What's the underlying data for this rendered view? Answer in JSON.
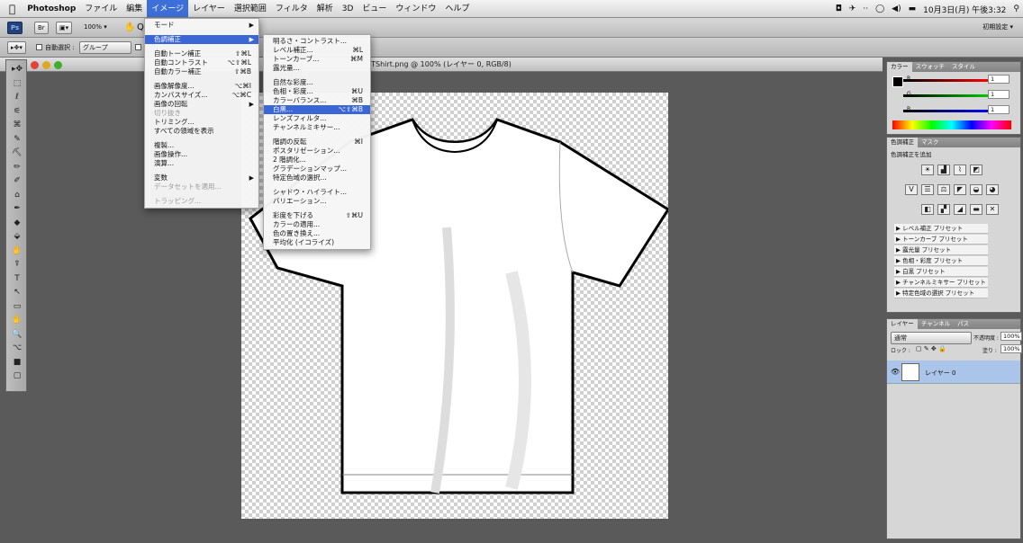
{
  "menubar": {
    "apple": "",
    "items": [
      "Photoshop",
      "ファイル",
      "編集",
      "イメージ",
      "レイヤー",
      "選択範囲",
      "フィルタ",
      "解析",
      "3D",
      "ビュー",
      "ウィンドウ",
      "ヘルプ"
    ],
    "status": [
      "◘",
      "✈",
      "··",
      "◯",
      "◀)",
      "▬",
      "10月3日(月) 午後3:32",
      "⚲"
    ]
  },
  "appbar": {
    "ps": "Ps",
    "br": "Br",
    "zoom": "100% ▾",
    "workspace": "初期設定 ▾"
  },
  "optionsbar": {
    "autoselect_label": "自動選択 :",
    "autoselect_value": "グループ",
    "transform_label": "バウ"
  },
  "document": {
    "title": "TShirt.png @ 100% (レイヤー 0, RGB/8)"
  },
  "tools": [
    "▸✥",
    "⬚",
    "ℓ",
    "⚟",
    "⌘",
    "✎",
    "⛏",
    "✏",
    "✐",
    "⌂",
    "✒",
    "◆",
    "⬙",
    "✋",
    "⍒",
    "T",
    "↖",
    "▭",
    "✋",
    "🔍",
    "⌥",
    "■",
    "▢"
  ],
  "image_menu": [
    {
      "label": "モード",
      "arrow": "▶"
    },
    {
      "sep": true
    },
    {
      "label": "色調補正",
      "arrow": "▶",
      "hl": true
    },
    {
      "sep": true
    },
    {
      "label": "自動トーン補正",
      "sc": "⇧⌘L"
    },
    {
      "label": "自動コントラスト",
      "sc": "⌥⇧⌘L"
    },
    {
      "label": "自動カラー補正",
      "sc": "⇧⌘B"
    },
    {
      "sep": true
    },
    {
      "label": "画像解像度...",
      "sc": "⌥⌘I"
    },
    {
      "label": "カンバスサイズ...",
      "sc": "⌥⌘C"
    },
    {
      "label": "画像の回転",
      "arrow": "▶"
    },
    {
      "label": "切り抜き",
      "dis": true
    },
    {
      "label": "トリミング..."
    },
    {
      "label": "すべての領域を表示"
    },
    {
      "sep": true
    },
    {
      "label": "複製..."
    },
    {
      "label": "画像操作..."
    },
    {
      "label": "演算..."
    },
    {
      "sep": true
    },
    {
      "label": "変数",
      "arrow": "▶"
    },
    {
      "label": "データセットを適用...",
      "dis": true
    },
    {
      "sep": true
    },
    {
      "label": "トラッピング...",
      "dis": true
    }
  ],
  "adjust_menu": [
    {
      "label": "明るさ・コントラスト..."
    },
    {
      "label": "レベル補正...",
      "sc": "⌘L"
    },
    {
      "label": "トーンカーブ...",
      "sc": "⌘M"
    },
    {
      "label": "露光量..."
    },
    {
      "sep": true
    },
    {
      "label": "自然な彩度..."
    },
    {
      "label": "色相・彩度...",
      "sc": "⌘U"
    },
    {
      "label": "カラーバランス...",
      "sc": "⌘B"
    },
    {
      "label": "白黒...",
      "sc": "⌥⇧⌘B",
      "hl": true
    },
    {
      "label": "レンズフィルタ..."
    },
    {
      "label": "チャンネルミキサー..."
    },
    {
      "sep": true
    },
    {
      "label": "階調の反転",
      "sc": "⌘I"
    },
    {
      "label": "ポスタリゼーション..."
    },
    {
      "label": "2 階調化..."
    },
    {
      "label": "グラデーションマップ..."
    },
    {
      "label": "特定色域の選択..."
    },
    {
      "sep": true
    },
    {
      "label": "シャドウ・ハイライト..."
    },
    {
      "label": "バリエーション..."
    },
    {
      "sep": true
    },
    {
      "label": "彩度を下げる",
      "sc": "⇧⌘U"
    },
    {
      "label": "カラーの適用..."
    },
    {
      "label": "色の置き換え..."
    },
    {
      "label": "平均化 (イコライズ)"
    }
  ],
  "color_panel": {
    "tabs": [
      "カラー",
      "スウォッチ",
      "スタイル"
    ],
    "r_label": "R",
    "g_label": "G",
    "b_label": "B",
    "r": "1",
    "g": "1",
    "b": "1"
  },
  "adjust_panel": {
    "tabs": [
      "色調補正",
      "マスク"
    ],
    "title": "色調補正を追加",
    "presets": [
      "▶ レベル補正 プリセット",
      "▶ トーンカーブ プリセット",
      "▶ 露光量 プリセット",
      "▶ 色相・彩度 プリセット",
      "▶ 白黒 プリセット",
      "▶ チャンネルミキサー プリセット",
      "▶ 特定色域の選択 プリセット"
    ]
  },
  "layers_panel": {
    "tabs": [
      "レイヤー",
      "チャンネル",
      "パス"
    ],
    "blend": "通常",
    "opacity_label": "不透明度 :",
    "opacity": "100%",
    "lock_label": "ロック :",
    "fill_label": "塗り :",
    "fill": "100%",
    "layer_name": "レイヤー 0"
  },
  "colors": {
    "menu_highlight": "#3b66d6",
    "canvas_bg": "#5a5a5a"
  }
}
